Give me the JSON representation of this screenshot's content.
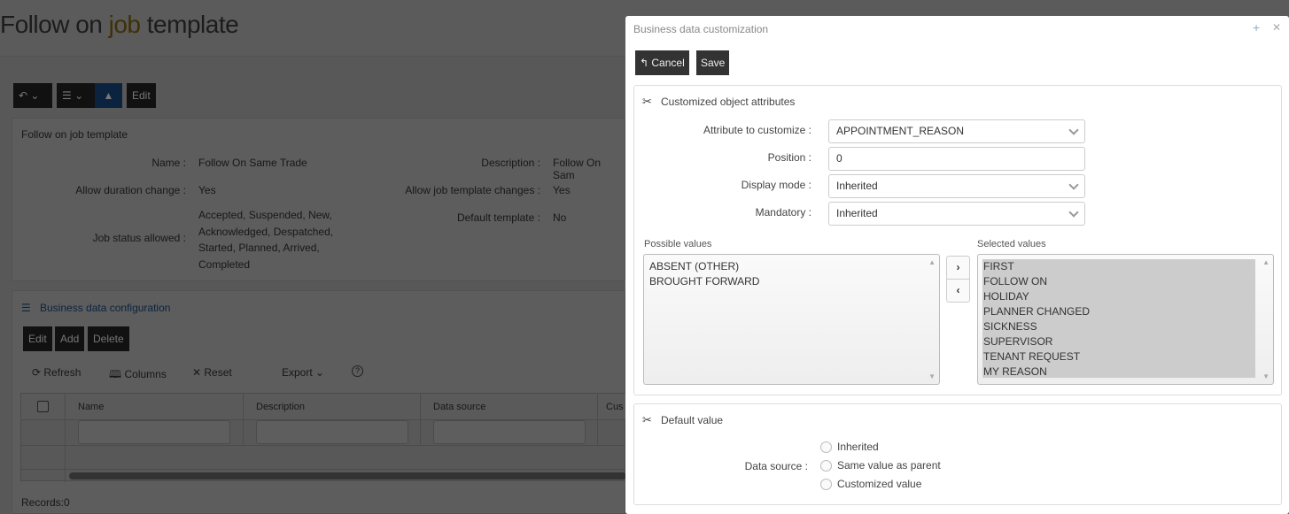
{
  "page": {
    "title_a": "Follow on ",
    "title_b": "job",
    " title_c": "",
    "title_c": " template",
    "toolbar": {
      "edit": "Edit"
    },
    "details": {
      "heading": "Follow on job template",
      "fields": [
        {
          "label": "Name :",
          "value": "Follow On Same Trade"
        },
        {
          "label": "Allow duration change :",
          "value": "Yes"
        },
        {
          "label": "Job status allowed :",
          "value": "Accepted, Suspended, New, Acknowledged, Despatched, Started, Planned, Arrived, Completed"
        }
      ],
      "fields_right": [
        {
          "label": "Description :",
          "value": "Follow On Sam"
        },
        {
          "label": "Allow job template changes :",
          "value": "Yes"
        },
        {
          "label": "Default template :",
          "value": "No"
        }
      ]
    },
    "bdc": {
      "heading": "Business data configuration",
      "buttons": [
        "Edit",
        "Add",
        "Delete"
      ],
      "tools": {
        "refresh": "Refresh",
        "columns": "Columns",
        "reset": "Reset",
        "export": "Export",
        "help": "?"
      },
      "columns": [
        "Name",
        "Description",
        "Data source",
        "Cus"
      ],
      "records": "Records:0"
    }
  },
  "dialog": {
    "title": "Business data customization",
    "cancel": "Cancel",
    "save": "Save",
    "attrs": {
      "heading": "Customized object attributes",
      "attribute": {
        "label": "Attribute to customize :",
        "value": "APPOINTMENT_REASON"
      },
      "position": {
        "label": "Position :",
        "value": "0"
      },
      "display": {
        "label": "Display mode :",
        "value": "Inherited"
      },
      "mandatory": {
        "label": "Mandatory :",
        "value": "Inherited"
      },
      "possible_label": "Possible values",
      "selected_label": "Selected values",
      "possible": [
        "ABSENT (OTHER)",
        "BROUGHT FORWARD"
      ],
      "selected": [
        "FIRST",
        "FOLLOW ON",
        "HOLIDAY",
        "PLANNER CHANGED",
        "SICKNESS",
        "SUPERVISOR",
        "TENANT REQUEST",
        "MY REASON"
      ]
    },
    "default": {
      "heading": "Default value",
      "label": "Data source :",
      "options": [
        "Inherited",
        "Same value as parent",
        "Customized value"
      ]
    }
  }
}
